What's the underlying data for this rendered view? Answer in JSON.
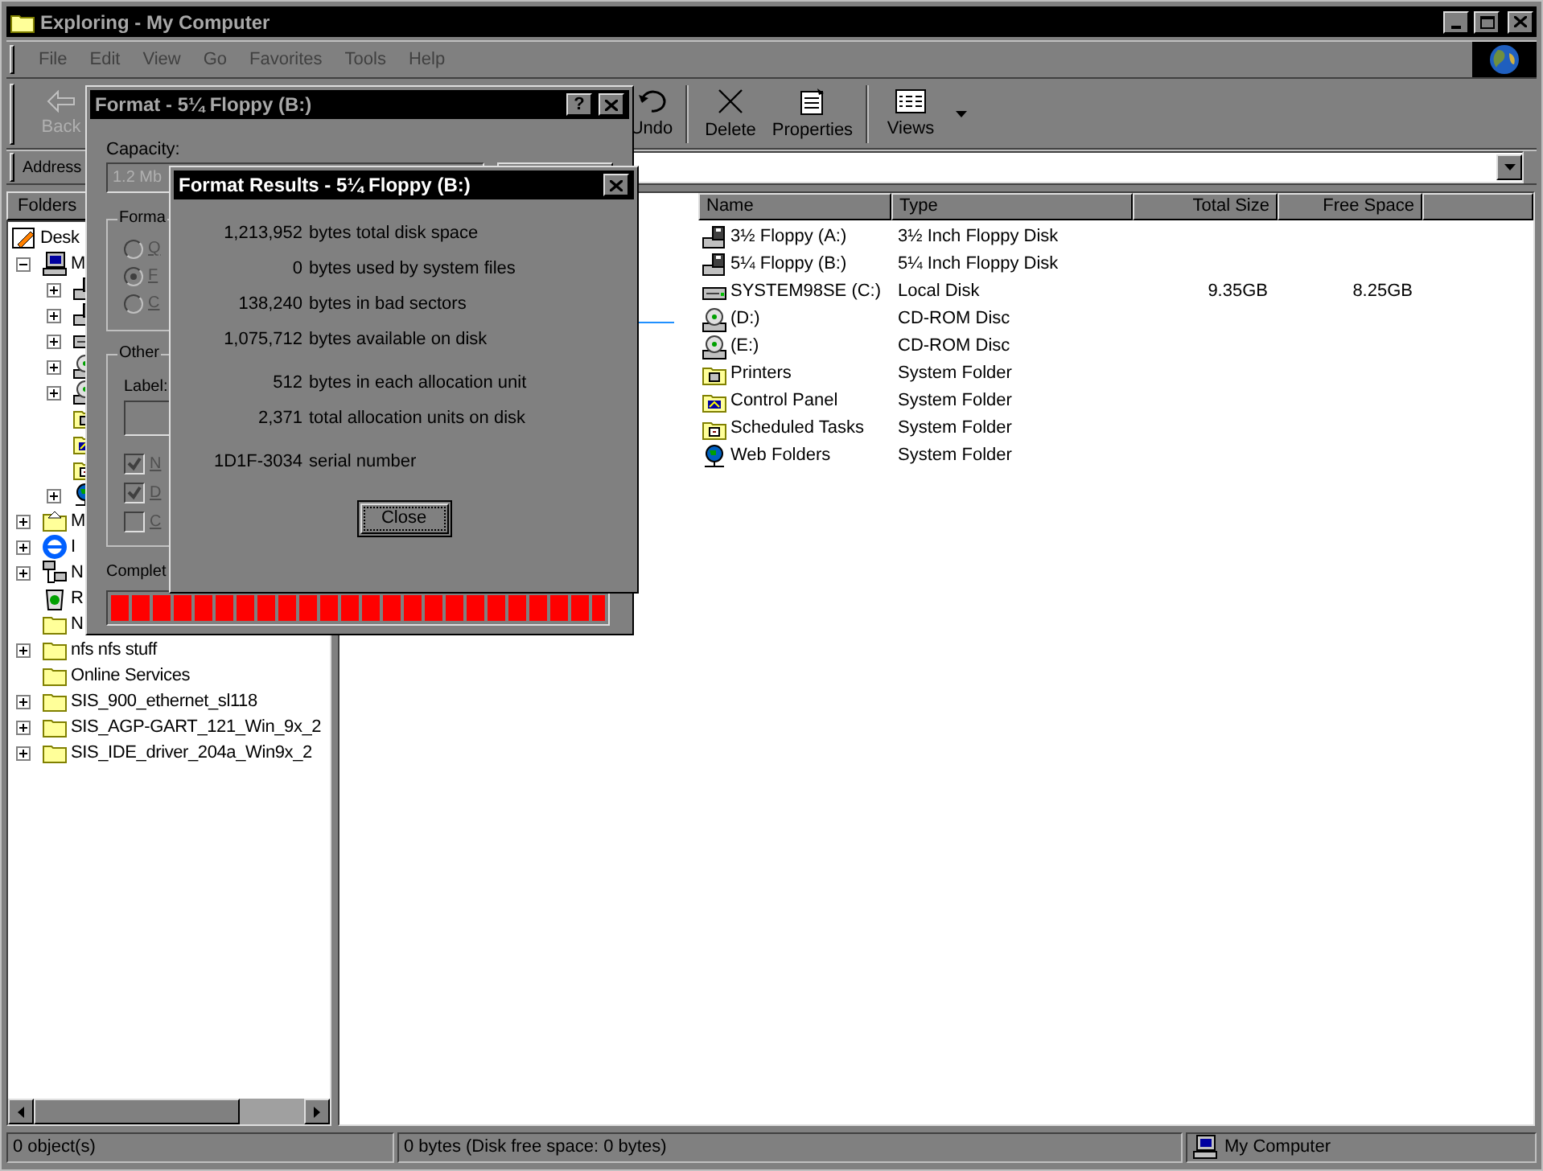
{
  "window": {
    "title": "Exploring - My Computer",
    "active": false
  },
  "menu": [
    {
      "label": "File"
    },
    {
      "label": "Edit"
    },
    {
      "label": "View"
    },
    {
      "label": "Go"
    },
    {
      "label": "Favorites"
    },
    {
      "label": "Tools"
    },
    {
      "label": "Help"
    }
  ],
  "toolbar": [
    {
      "kind": "back",
      "label": "Back",
      "disabled": true
    },
    {
      "kind": "undo",
      "label": "Undo",
      "disabled": false
    },
    {
      "kind": "separator"
    },
    {
      "kind": "delete",
      "label": "Delete",
      "disabled": false
    },
    {
      "kind": "properties",
      "label": "Properties",
      "disabled": false
    },
    {
      "kind": "separator"
    },
    {
      "kind": "views",
      "label": "Views",
      "disabled": false
    }
  ],
  "address": {
    "label": "Address"
  },
  "folders_pane": {
    "title": "Folders",
    "tree": [
      {
        "label": "Desk",
        "kind": "desktop",
        "expandable": false,
        "children": [
          {
            "label": "M",
            "kind": "computer",
            "expandable": true,
            "expanded": true,
            "children": [
              {
                "kind": "floppy",
                "expandable": true,
                "expanded": false
              },
              {
                "kind": "floppy",
                "expandable": true,
                "expanded": false
              },
              {
                "kind": "disk",
                "expandable": true,
                "expanded": false
              },
              {
                "kind": "cdrom",
                "expandable": true,
                "expanded": false
              },
              {
                "kind": "cdrom",
                "expandable": true,
                "expanded": false
              },
              {
                "kind": "printers",
                "expandable": false
              },
              {
                "kind": "control_panel",
                "expandable": false
              },
              {
                "kind": "tasks",
                "expandable": false
              },
              {
                "kind": "web_folders",
                "expandable": true,
                "expanded": false
              }
            ]
          },
          {
            "label": "M",
            "kind": "documents",
            "expandable": true,
            "expanded": false
          },
          {
            "label": "I",
            "kind": "ie",
            "expandable": true,
            "expanded": false
          },
          {
            "label": "N",
            "kind": "network",
            "expandable": true,
            "expanded": false
          },
          {
            "label": "R",
            "kind": "recycle",
            "expandable": false
          },
          {
            "label": "N",
            "kind": "folder",
            "expandable": false
          },
          {
            "label": "nfs nfs stuff",
            "kind": "folder",
            "expandable": true,
            "expanded": false
          },
          {
            "label": "Online Services",
            "kind": "folder",
            "expandable": false
          },
          {
            "label": "SIS_900_ethernet_sl118",
            "kind": "folder",
            "expandable": true,
            "expanded": false
          },
          {
            "label": "SIS_AGP-GART_121_Win_9x_2",
            "kind": "folder",
            "expandable": true,
            "expanded": false
          },
          {
            "label": "SIS_IDE_driver_204a_Win9x_2",
            "kind": "folder",
            "expandable": true,
            "expanded": false
          }
        ]
      }
    ]
  },
  "file_list": {
    "columns": [
      {
        "label": "Name",
        "kind": "text"
      },
      {
        "label": "Type",
        "kind": "text"
      },
      {
        "label": "Total Size",
        "kind": "number"
      },
      {
        "label": "Free Space",
        "kind": "number"
      }
    ],
    "rows": [
      {
        "kind": "floppy",
        "name": "3½ Floppy (A:)",
        "type": "3½ Inch Floppy Disk"
      },
      {
        "kind": "floppy",
        "name": "5¼ Floppy (B:)",
        "type": "5¼ Inch Floppy Disk"
      },
      {
        "kind": "disk",
        "name": "SYSTEM98SE (C:)",
        "type": "Local Disk",
        "total_size": "9.35GB",
        "free_space": "8.25GB"
      },
      {
        "kind": "cdrom",
        "name": "(D:)",
        "type": "CD-ROM Disc"
      },
      {
        "kind": "cdrom",
        "name": "(E:)",
        "type": "CD-ROM Disc"
      },
      {
        "kind": "printers",
        "name": "Printers",
        "type": "System Folder"
      },
      {
        "kind": "control_panel",
        "name": "Control Panel",
        "type": "System Folder"
      },
      {
        "kind": "tasks",
        "name": "Scheduled Tasks",
        "type": "System Folder"
      },
      {
        "kind": "web_folders",
        "name": "Web Folders",
        "type": "System Folder"
      }
    ]
  },
  "status_bar": {
    "objects": "0 object(s)",
    "size": "0 bytes (Disk free space: 0 bytes)",
    "zone": "My Computer"
  },
  "format_dialog": {
    "title": "Format - 5¼ Floppy (B:)",
    "active": false,
    "help_button": "?",
    "capacity_label": "Capacity:",
    "capacity_value": "1.2 Mb",
    "format_group": "Forma",
    "format_options": [
      {
        "label": "Q",
        "selected": false,
        "disabled": true
      },
      {
        "label": "F",
        "selected": true,
        "disabled": true
      },
      {
        "label": "C",
        "selected": false,
        "disabled": true
      }
    ],
    "other_group": "Other",
    "label_label": "Label:",
    "other_options": [
      {
        "label": "N",
        "checked": true,
        "disabled": true
      },
      {
        "label": "D",
        "checked": true,
        "disabled": true
      },
      {
        "label": "C",
        "checked": false,
        "disabled": true
      }
    ],
    "progress_label": "Complet",
    "progress": {
      "level": 1
    }
  },
  "results_dialog": {
    "title": "Format Results - 5¼ Floppy (B:)",
    "active": true,
    "groups": [
      [
        {
          "value": "1,213,952",
          "text": "bytes total disk space"
        },
        {
          "value": "0",
          "text": "bytes used by system files"
        },
        {
          "value": "138,240",
          "text": "bytes in bad sectors"
        },
        {
          "value": "1,075,712",
          "text": "bytes available on disk"
        }
      ],
      [
        {
          "value": "512",
          "text": "bytes in each allocation unit"
        },
        {
          "value": "2,371",
          "text": "total allocation units on disk"
        }
      ],
      [
        {
          "value": "1D1F-3034",
          "text": "serial number"
        }
      ]
    ],
    "close_button": "Close"
  }
}
